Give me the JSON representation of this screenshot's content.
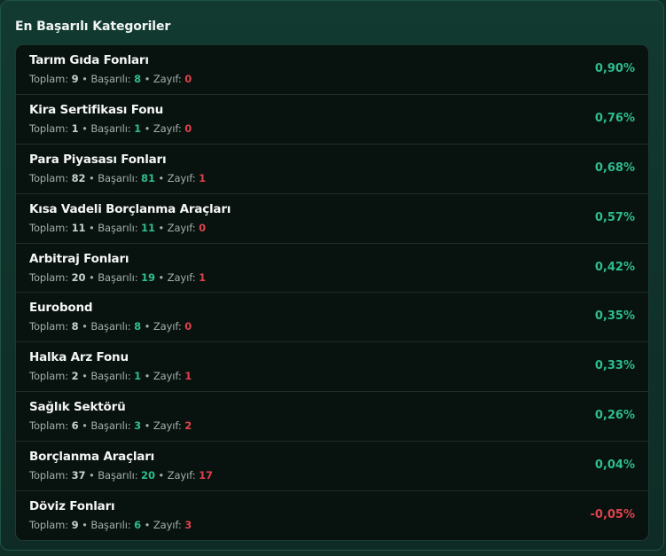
{
  "panel": {
    "title": "En Başarılı Kategoriler",
    "labels": {
      "total": "Toplam:",
      "good": "Başarılı:",
      "bad": "Zayıf:",
      "sep": "•"
    },
    "colors": {
      "positive": "#2ebd8f",
      "negative": "#e0424c"
    }
  },
  "categories": [
    {
      "name": "Tarım Gıda Fonları",
      "total": "9",
      "good": "8",
      "bad": "0",
      "pct": "0,90%",
      "negative": false
    },
    {
      "name": "Kira Sertifikası Fonu",
      "total": "1",
      "good": "1",
      "bad": "0",
      "pct": "0,76%",
      "negative": false
    },
    {
      "name": "Para Piyasası Fonları",
      "total": "82",
      "good": "81",
      "bad": "1",
      "pct": "0,68%",
      "negative": false
    },
    {
      "name": "Kısa Vadeli Borçlanma Araçları",
      "total": "11",
      "good": "11",
      "bad": "0",
      "pct": "0,57%",
      "negative": false
    },
    {
      "name": "Arbitraj Fonları",
      "total": "20",
      "good": "19",
      "bad": "1",
      "pct": "0,42%",
      "negative": false
    },
    {
      "name": "Eurobond",
      "total": "8",
      "good": "8",
      "bad": "0",
      "pct": "0,35%",
      "negative": false
    },
    {
      "name": "Halka Arz Fonu",
      "total": "2",
      "good": "1",
      "bad": "1",
      "pct": "0,33%",
      "negative": false
    },
    {
      "name": "Sağlık Sektörü",
      "total": "6",
      "good": "3",
      "bad": "2",
      "pct": "0,26%",
      "negative": false
    },
    {
      "name": "Borçlanma Araçları",
      "total": "37",
      "good": "20",
      "bad": "17",
      "pct": "0,04%",
      "negative": false
    },
    {
      "name": "Döviz Fonları",
      "total": "9",
      "good": "6",
      "bad": "3",
      "pct": "-0,05%",
      "negative": true
    }
  ]
}
